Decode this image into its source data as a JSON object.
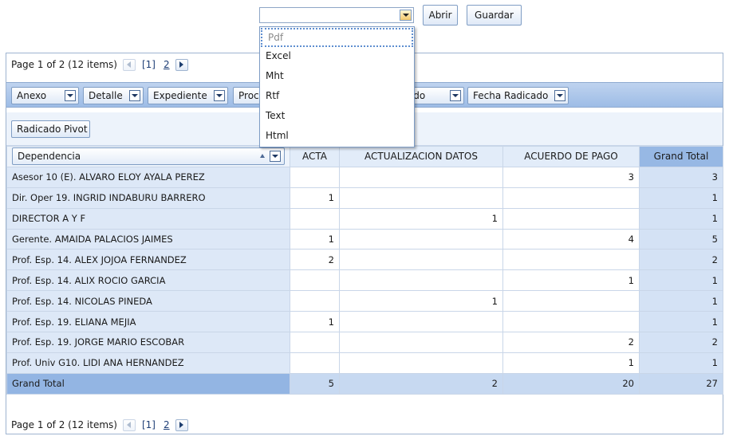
{
  "toolbar": {
    "format_value": "",
    "open_label": "Abrir",
    "save_label": "Guardar",
    "format_options": [
      "Pdf",
      "Excel",
      "Mht",
      "Rtf",
      "Text",
      "Html"
    ],
    "highlighted_option": "Pdf"
  },
  "pager": {
    "summary": "Page 1 of 2 (12 items)",
    "current_page": "[1]",
    "next_page": "2"
  },
  "filter_fields": [
    "Anexo",
    "Detalle",
    "Expediente",
    "Proc",
    "icado",
    "Fecha Radicado"
  ],
  "data_field": "Radicado Pivot",
  "row_field": "Dependencia",
  "columns": [
    "ACTA",
    "ACTUALIZACION DATOS",
    "ACUERDO DE PAGO",
    "Grand Total"
  ],
  "rows": [
    {
      "label": "Asesor 10 (E). ALVARO ELOY AYALA PEREZ",
      "values": [
        "",
        "",
        "3"
      ],
      "total": "3"
    },
    {
      "label": "Dir. Oper 19. INGRID INDABURU BARRERO",
      "values": [
        "1",
        "",
        ""
      ],
      "total": "1"
    },
    {
      "label": "DIRECTOR A Y F",
      "values": [
        "",
        "1",
        ""
      ],
      "total": "1"
    },
    {
      "label": "Gerente. AMAIDA PALACIOS JAIMES",
      "values": [
        "1",
        "",
        "4"
      ],
      "total": "5"
    },
    {
      "label": "Prof. Esp. 14. ALEX JOJOA FERNANDEZ",
      "values": [
        "2",
        "",
        ""
      ],
      "total": "2"
    },
    {
      "label": "Prof. Esp. 14. ALIX ROCIO GARCIA",
      "values": [
        "",
        "",
        "1"
      ],
      "total": "1"
    },
    {
      "label": "Prof. Esp. 14. NICOLAS PINEDA",
      "values": [
        "",
        "1",
        ""
      ],
      "total": "1"
    },
    {
      "label": "Prof. Esp. 19. ELIANA MEJIA",
      "values": [
        "1",
        "",
        ""
      ],
      "total": "1"
    },
    {
      "label": "Prof. Esp. 19. JORGE MARIO ESCOBAR",
      "values": [
        "",
        "",
        "2"
      ],
      "total": "2"
    },
    {
      "label": "Prof. Univ G10. LIDI ANA HERNANDEZ",
      "values": [
        "",
        "",
        "1"
      ],
      "total": "1"
    }
  ],
  "grand_total_row": {
    "label": "Grand Total",
    "values": [
      "5",
      "2",
      "20"
    ],
    "total": "27"
  }
}
